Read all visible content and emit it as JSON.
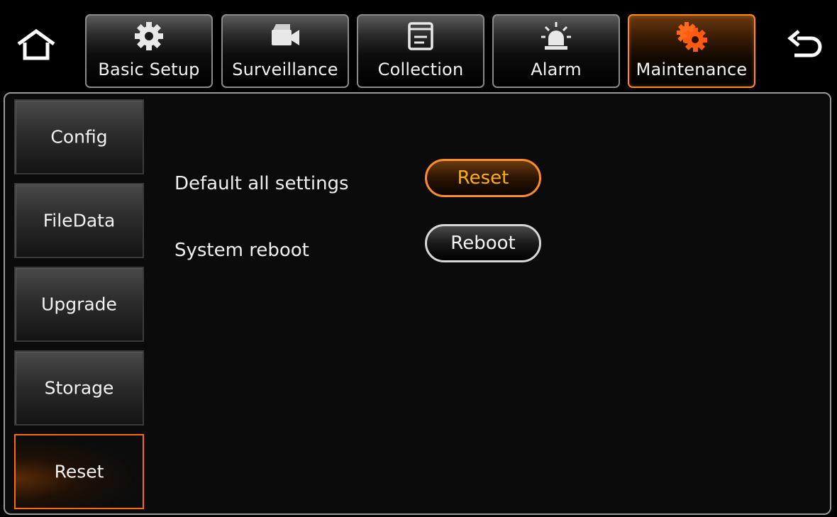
{
  "topbar": {
    "tabs": [
      {
        "label": "Basic Setup",
        "icon": "gear-icon"
      },
      {
        "label": "Surveillance",
        "icon": "camera-icon"
      },
      {
        "label": "Collection",
        "icon": "window-icon"
      },
      {
        "label": "Alarm",
        "icon": "alarm-light-icon"
      },
      {
        "label": "Maintenance",
        "icon": "gears-icon"
      }
    ],
    "active_tab": "Maintenance",
    "home_icon": "home-icon",
    "back_icon": "back-icon"
  },
  "sidebar": {
    "items": [
      {
        "label": "Config"
      },
      {
        "label": "FileData"
      },
      {
        "label": "Upgrade"
      },
      {
        "label": "Storage"
      },
      {
        "label": "Reset"
      }
    ],
    "active_item": "Reset"
  },
  "content": {
    "default_label": "Default all settings",
    "reset_button": "Reset",
    "reboot_label": "System reboot",
    "reboot_button": "Reboot"
  },
  "colors": {
    "accent": "#ff8a1e",
    "button_highlight_text": "#ffb000",
    "panel_border": "#9a9a9a"
  }
}
